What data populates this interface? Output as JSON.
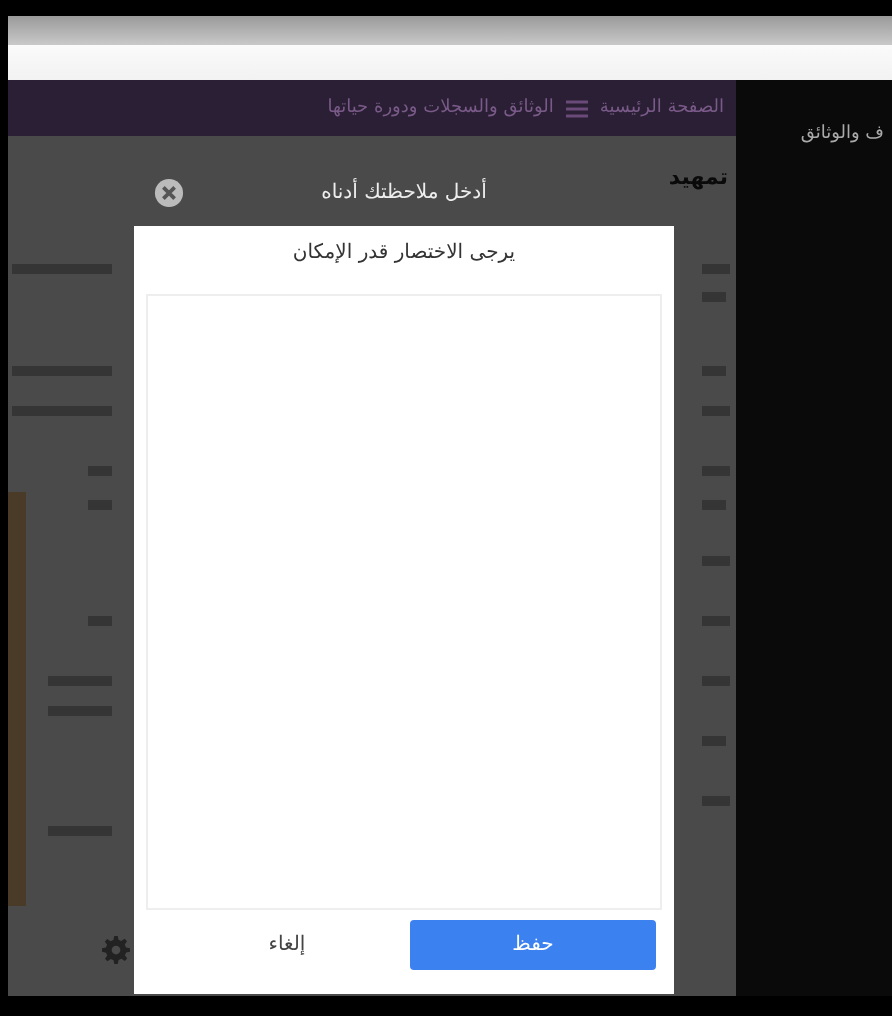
{
  "header": {
    "home_link": "الصفحة الرئيسية",
    "section_title": "الوثائق والسجلات ودورة حياتها"
  },
  "side_panel": {
    "title": "ف والوثائق"
  },
  "page": {
    "heading": "تمهيد"
  },
  "modal": {
    "title": "أدخل ملاحظتك أدناه",
    "subtitle": "يرجى الاختصار قدر الإمكان",
    "buttons": [
      {
        "label": "حفظ",
        "kind": "primary"
      },
      {
        "label": "إلغاء",
        "kind": "plain"
      }
    ]
  }
}
